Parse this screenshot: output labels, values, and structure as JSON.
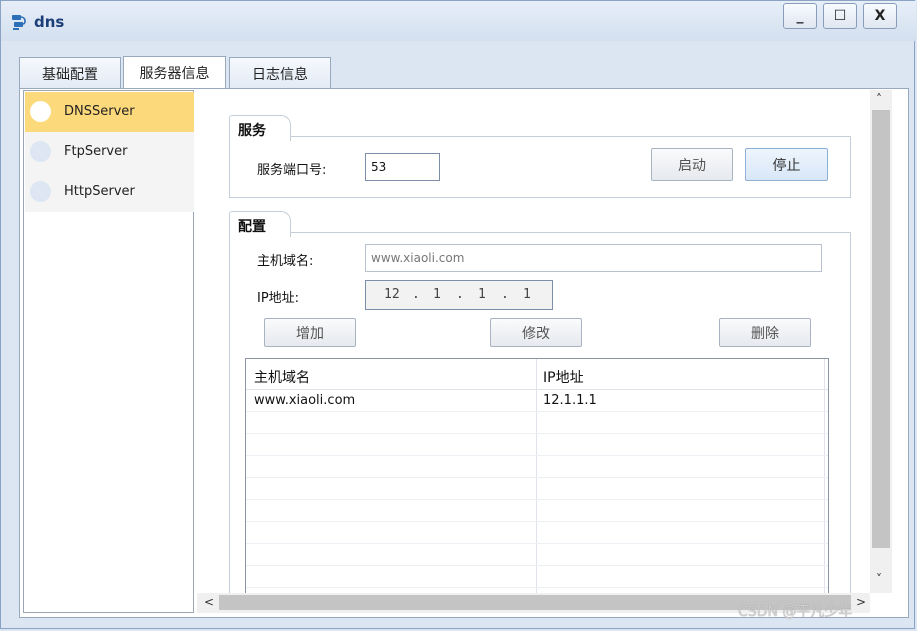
{
  "window": {
    "title": "dns",
    "icon": "network-cable-icon",
    "controls": {
      "minimize": "_",
      "maximize": "☐",
      "close": "X"
    }
  },
  "tabs": [
    {
      "label": "基础配置",
      "active": false
    },
    {
      "label": "服务器信息",
      "active": true
    },
    {
      "label": "日志信息",
      "active": false
    }
  ],
  "servers": [
    {
      "label": "DNSServer",
      "active": true
    },
    {
      "label": "FtpServer",
      "active": false
    },
    {
      "label": "HttpServer",
      "active": false
    }
  ],
  "service": {
    "group_title": "服务",
    "port_label": "服务端口号:",
    "port_value": "53",
    "start_button": "启动",
    "stop_button": "停止"
  },
  "config": {
    "group_title": "配置",
    "hostname_label": "主机域名:",
    "hostname_placeholder": "www.xiaoli.com",
    "ip_label": "IP地址:",
    "ip_segments": [
      "12",
      "1",
      "1",
      "1"
    ],
    "add_button": "增加",
    "edit_button": "修改",
    "delete_button": "删除"
  },
  "table": {
    "columns": [
      "主机域名",
      "IP地址"
    ],
    "rows": [
      {
        "host": "www.xiaoli.com",
        "ip": "12.1.1.1"
      }
    ]
  },
  "scrollbars": {
    "up": "˄",
    "down": "˅",
    "left": "<",
    "right": ">"
  },
  "watermark": "CSDN @平凡少年"
}
